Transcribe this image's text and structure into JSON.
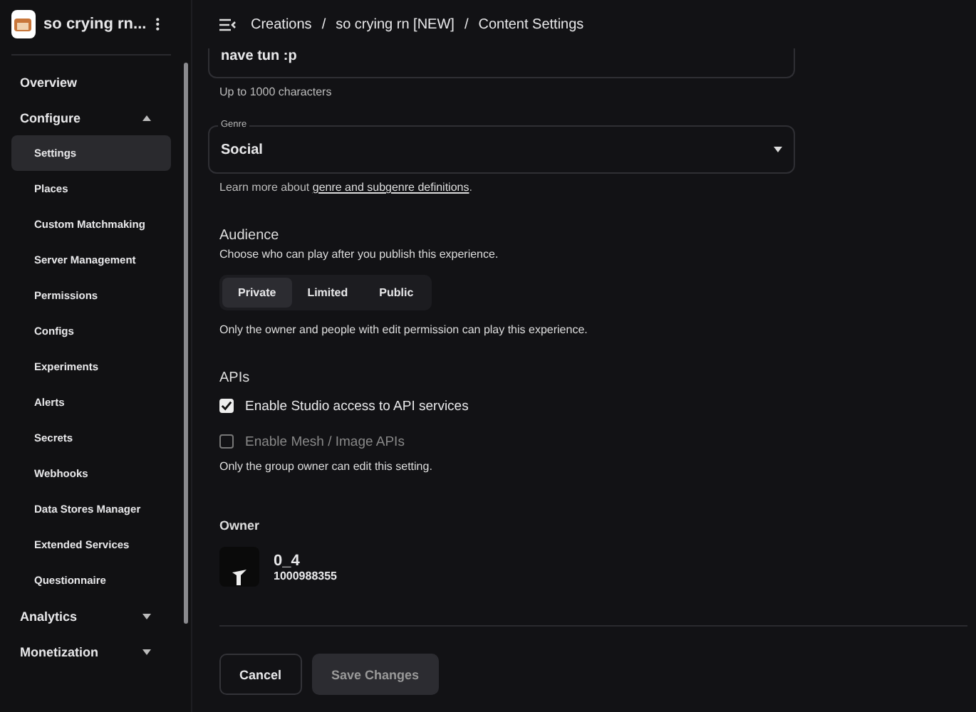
{
  "sidebar": {
    "experience_name": "so crying rn...",
    "sections": [
      {
        "label": "Overview"
      },
      {
        "label": "Configure",
        "expanded": true,
        "items": [
          {
            "label": "Settings",
            "selected": true
          },
          {
            "label": "Places",
            "selected": false
          },
          {
            "label": "Custom Matchmaking",
            "selected": false
          },
          {
            "label": "Server Management",
            "selected": false
          },
          {
            "label": "Permissions",
            "selected": false
          },
          {
            "label": "Configs",
            "selected": false
          },
          {
            "label": "Experiments",
            "selected": false
          },
          {
            "label": "Alerts",
            "selected": false
          },
          {
            "label": "Secrets",
            "selected": false
          },
          {
            "label": "Webhooks",
            "selected": false
          },
          {
            "label": "Data Stores Manager",
            "selected": false
          },
          {
            "label": "Extended Services",
            "selected": false
          },
          {
            "label": "Questionnaire",
            "selected": false
          }
        ]
      },
      {
        "label": "Analytics",
        "expanded": false
      },
      {
        "label": "Monetization",
        "expanded": false
      }
    ]
  },
  "breadcrumb": {
    "separator": "/",
    "items": [
      "Creations",
      "so crying rn [NEW]",
      "Content Settings"
    ]
  },
  "description": {
    "value": "nave tun :p",
    "helper": "Up to 1000 characters"
  },
  "genre": {
    "label": "Genre",
    "value": "Social",
    "help_prefix": "Learn more about ",
    "help_link": "genre and subgenre definitions",
    "help_suffix": "."
  },
  "audience": {
    "title": "Audience",
    "subtitle": "Choose who can play after you publish this experience.",
    "options": [
      {
        "label": "Private",
        "selected": true
      },
      {
        "label": "Limited",
        "selected": false
      },
      {
        "label": "Public",
        "selected": false
      }
    ],
    "note": "Only the owner and people with edit permission can play this experience."
  },
  "apis": {
    "title": "APIs",
    "options": [
      {
        "label": "Enable Studio access to API services",
        "checked": true,
        "disabled": false
      },
      {
        "label": "Enable Mesh / Image APIs",
        "checked": false,
        "disabled": true
      }
    ],
    "note": "Only the group owner can edit this setting."
  },
  "owner": {
    "title": "Owner",
    "name": "0_4",
    "id": "1000988355"
  },
  "buttons": [
    {
      "label": "Cancel",
      "kind": "outline",
      "disabled": false
    },
    {
      "label": "Save Changes",
      "kind": "filled",
      "disabled": true
    }
  ]
}
